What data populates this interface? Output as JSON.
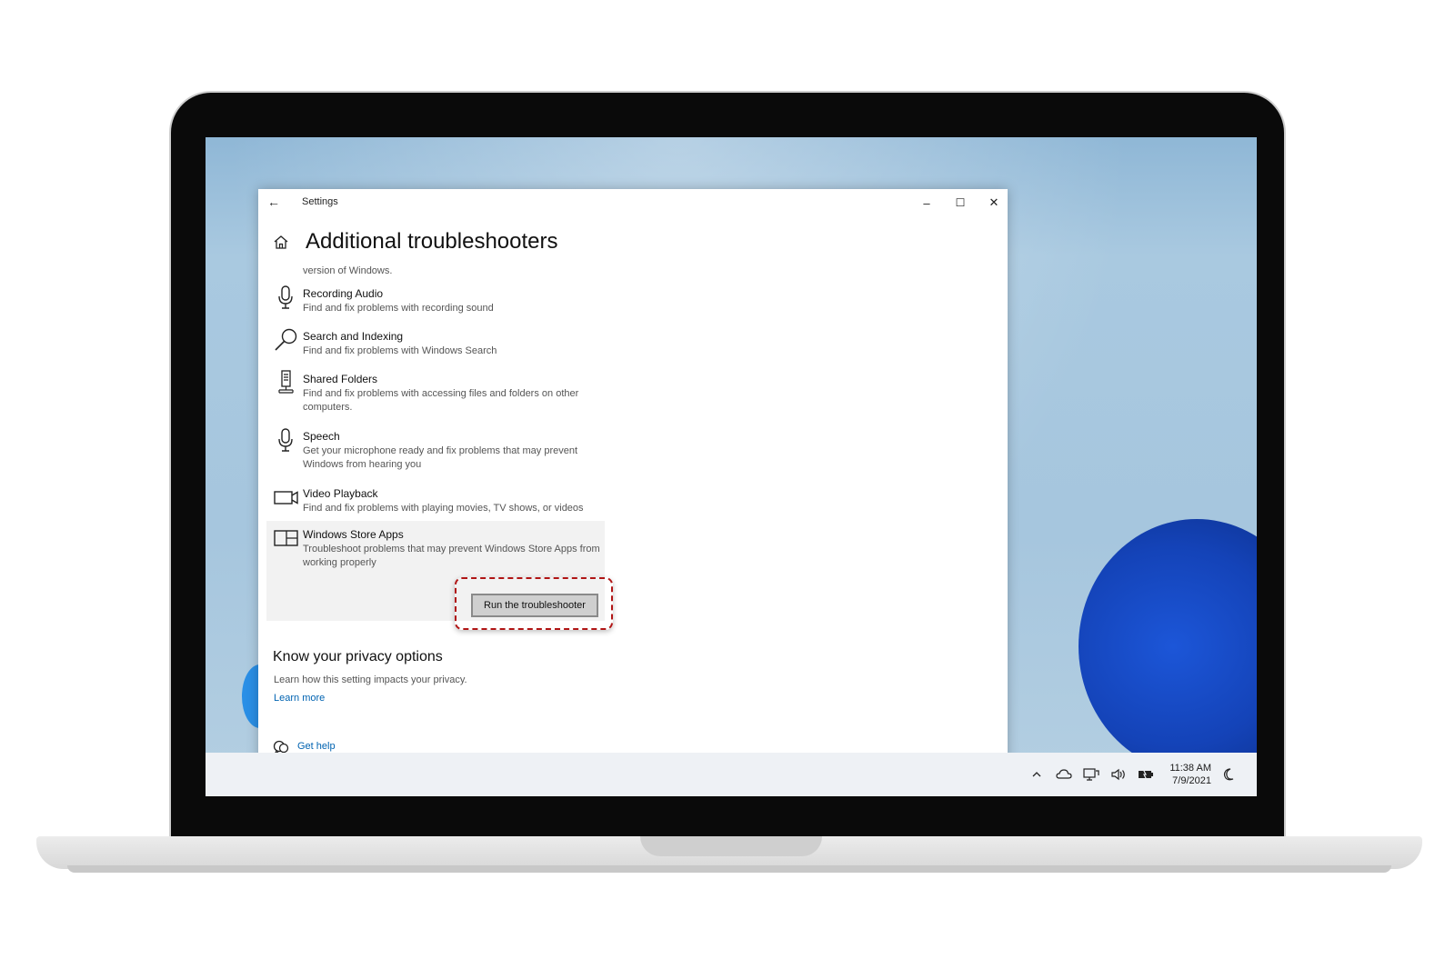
{
  "window": {
    "title": "Settings",
    "minimize_glyph": "–",
    "maximize_glyph": "☐",
    "close_glyph": "✕",
    "back_glyph": "←"
  },
  "page": {
    "title": "Additional troubleshooters",
    "truncated_text": "version of Windows."
  },
  "troubleshooters": [
    {
      "title": "Recording Audio",
      "desc": "Find and fix problems with recording sound",
      "icon": "microphone-icon"
    },
    {
      "title": "Search and Indexing",
      "desc": "Find and fix problems with Windows Search",
      "icon": "search-icon"
    },
    {
      "title": "Shared Folders",
      "desc": "Find and fix problems with accessing files and folders on other computers.",
      "icon": "shared-folders-icon"
    },
    {
      "title": "Speech",
      "desc": "Get your microphone ready and fix problems that may prevent Windows from hearing you",
      "icon": "microphone-icon"
    },
    {
      "title": "Video Playback",
      "desc": "Find and fix problems with playing movies, TV shows, or videos",
      "icon": "video-camera-icon"
    },
    {
      "title": "Windows Store Apps",
      "desc": "Troubleshoot problems that may prevent Windows Store Apps from working properly",
      "icon": "store-apps-icon"
    }
  ],
  "run_button_label": "Run the troubleshooter",
  "privacy": {
    "heading": "Know your privacy options",
    "desc": "Learn how this setting impacts your privacy.",
    "link": "Learn more"
  },
  "help_link": "Get help",
  "taskbar": {
    "time": "11:38 AM",
    "date": "7/9/2021"
  },
  "colors": {
    "link": "#0063b1",
    "highlight_border": "#b01515",
    "selected_row": "#f2f2f2"
  }
}
